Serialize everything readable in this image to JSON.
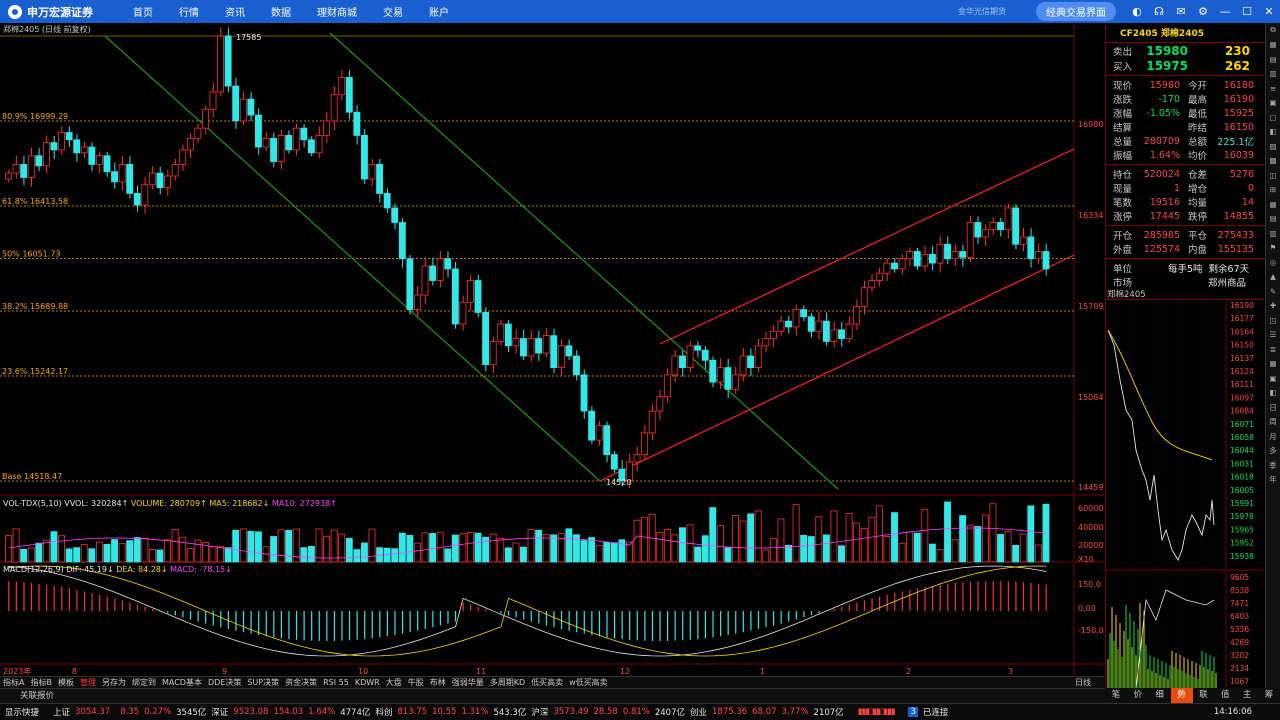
{
  "app": {
    "logo_text": "申万宏源证券",
    "classic_button": "经典交易界面",
    "fuzzy_hint": "金华光信期货"
  },
  "menu": [
    "首页",
    "行情",
    "资讯",
    "数据",
    "理财商城",
    "交易",
    "账户"
  ],
  "chart": {
    "title": "郑棉2405 (日线 前复权)",
    "fib_labels": [
      "80.9% 16999.29",
      "61.8% 16413.58",
      "50% 16051.73",
      "38.2% 15689.88",
      "23.6% 15242.17",
      "Base 14518.47"
    ],
    "high_label": "17585",
    "low_label": "14520",
    "price_axis": [
      "16980",
      "16334",
      "15709",
      "15084",
      "14459"
    ],
    "vol_axis": [
      "60000",
      "40000",
      "20000",
      "X10"
    ],
    "macd_axis": [
      "150.0",
      "0.00",
      "-150.0"
    ],
    "date_axis": [
      "2023年",
      "8",
      "9",
      "10",
      "11",
      "12",
      "1",
      "2",
      "3"
    ],
    "vol_legend": {
      "name": "VOL-TDX(5,10)",
      "vvol": "VVOL: 320284↑",
      "volume": "VOLUME: 280709↑",
      "ma5": "MA5: 218682↓",
      "ma10": "MA10: 272938↑"
    },
    "macd_legend": {
      "name": "MACD(12,26,9)",
      "dif": "DIF: 45.19↓",
      "dea": "DEA: 84.28↓",
      "macd": "MACD: -78.15↓"
    },
    "period_label": "日线"
  },
  "colors": {
    "up": "#ff3030",
    "down": "#30e8e8",
    "fib": "#ffa500",
    "channel_green": "#1a9a1a",
    "channel_red": "#ff2020",
    "menubar": "#1a5fd0"
  },
  "quote": {
    "code_title": "CF2405 郑棉2405",
    "sell": {
      "label": "卖出",
      "price": "15980",
      "vol": "230"
    },
    "buy": {
      "label": "买入",
      "price": "15975",
      "vol": "262"
    },
    "rows": [
      [
        "现价",
        "15980",
        "今开",
        "16180"
      ],
      [
        "涨跌",
        "-170",
        "最高",
        "16190"
      ],
      [
        "涨幅",
        "-1.05%",
        "最低",
        "15925"
      ],
      [
        "结算",
        "",
        "昨结",
        "16150"
      ],
      [
        "总量",
        "280709",
        "总额",
        "225.1亿"
      ],
      [
        "振幅",
        "1.64%",
        "均价",
        "16039"
      ]
    ],
    "rows2": [
      [
        "持仓",
        "520024",
        "仓差",
        "5276"
      ],
      [
        "现量",
        "1",
        "增仓",
        "0"
      ],
      [
        "笔数",
        "19516",
        "均量",
        "14"
      ],
      [
        "涨停",
        "17445",
        "跌停",
        "14855"
      ]
    ],
    "rows3": [
      [
        "开仓",
        "285985",
        "平仓",
        "275433"
      ],
      [
        "外盘",
        "125574",
        "内盘",
        "155135"
      ]
    ],
    "unit_label": "单位",
    "unit_value": "每手5吨",
    "remain": "剩余67天",
    "market_label": "市场",
    "market_value": "郑州商品"
  },
  "mini_chart": {
    "title": "郑棉2405",
    "price_axis": [
      "16190",
      "16177",
      "16164",
      "16150",
      "16137",
      "16124",
      "16111",
      "16097",
      "16084",
      "16071",
      "16058",
      "16044",
      "16031",
      "16018",
      "16005",
      "15991",
      "15978",
      "15965",
      "15952",
      "15938"
    ],
    "vol_axis": [
      "9605",
      "8538",
      "7471",
      "6403",
      "5336",
      "4269",
      "3202",
      "2134",
      "1067"
    ]
  },
  "right_tools": [
    "日",
    "周",
    "月",
    "多",
    "季",
    "年"
  ],
  "bottom_tabs": [
    "指标A",
    "指标B",
    "模板",
    "管理",
    "另存为",
    "绑定到",
    "MACD基本",
    "DDE决策",
    "SUP决策",
    "资金决策",
    "RSI 55",
    "KDWR",
    "大盘",
    "牛股",
    "布林",
    "强弱华量",
    "多周期KD",
    "低买高卖",
    "w低买高卖"
  ],
  "active_bottom_tab": "管理",
  "sub_tabs": [
    "笔",
    "价",
    "细",
    "势",
    "联",
    "值",
    "主",
    "筹"
  ],
  "active_sub_tab": "势",
  "alert_text": "关联报价",
  "status": {
    "quick": "显示快捷",
    "sh_label": "上证",
    "sh_val": "3054.37",
    "sh_chg": "8.35",
    "sh_pct": "0.27%",
    "sh_amt": "3545亿",
    "sz_label": "深证",
    "sz_val": "9523.08",
    "sz_chg": "154.03",
    "sz_pct": "1.64%",
    "sz_amt": "4774亿",
    "kc_label": "科创",
    "kc_val": "813.75",
    "kc_chg": "10.55",
    "kc_pct": "1.31%",
    "kc_amt": "543.3亿",
    "hs_label": "沪深",
    "hs_val": "3573.49",
    "hs_chg": "28.58",
    "hs_pct": "0.81%",
    "hs_amt": "2407亿",
    "cy_label": "创业",
    "cy_val": "1875.36",
    "cy_chg": "68.07",
    "cy_pct": "3.77%",
    "cy_amt": "2107亿",
    "conn": "已连接",
    "time": "14:16:06"
  }
}
